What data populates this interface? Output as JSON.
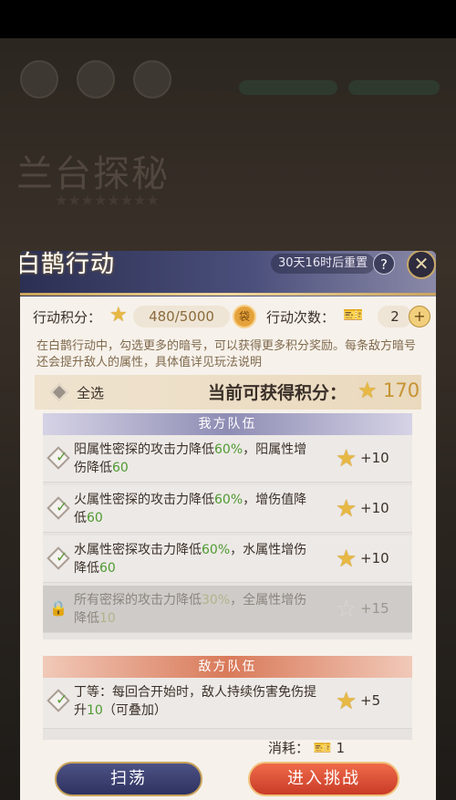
{
  "background": {
    "title": "兰台探秘",
    "subtitle": "★★★★★★★★"
  },
  "modal": {
    "title": "白鹊行动",
    "reset_text": "30天16时后重置",
    "help_label": "?",
    "close_label": "✕",
    "points_label": "行动积分：",
    "points_value": "480/5000",
    "actions_label": "行动次数：",
    "actions_value": "2",
    "plus_label": "+",
    "description": "在白鹊行动中，勾选更多的暗号，可以获得更多积分奖励。每条敌方暗号还会提升敌人的属性，具体值详见玩法说明",
    "select_all": "全选",
    "current_label": "当前可获得积分：",
    "current_value": "170",
    "my_team": {
      "header": "我方队伍",
      "items": [
        {
          "pre": "阳属性密探的攻击力降低",
          "p1": "60%",
          "mid": "，阳属性增伤降低",
          "p2": "60",
          "reward": "+10",
          "checked": true
        },
        {
          "pre": "火属性密探的攻击力降低",
          "p1": "60%",
          "mid": "，增伤值降低",
          "p2": "60",
          "reward": "+10",
          "checked": true
        },
        {
          "pre": "水属性密探攻击力降低",
          "p1": "60%",
          "mid": "，水属性增伤降低",
          "p2": "60",
          "reward": "+10",
          "checked": true
        },
        {
          "pre": "所有密探的攻击力降低",
          "p1": "30%",
          "mid": "，全属性增伤降低",
          "p2": "10",
          "reward": "+15",
          "checked": false
        }
      ]
    },
    "enemy_team": {
      "header": "敌方队伍",
      "items": [
        {
          "pre": "丁等：每回合开始时，敌人持续伤害免伤提升",
          "p1": "10",
          "mid": "（可叠加）",
          "reward": "+5",
          "checked": true
        }
      ]
    },
    "cost_label": "消耗：",
    "cost_value": "1",
    "sweep_button": "扫荡",
    "challenge_button": "进入挑战"
  },
  "colors": {
    "accent_gold": "#e7b843",
    "highlight_green": "#4f9a32",
    "header_purple": "#4a4f7b",
    "enemy_red": "#d97a5a"
  }
}
